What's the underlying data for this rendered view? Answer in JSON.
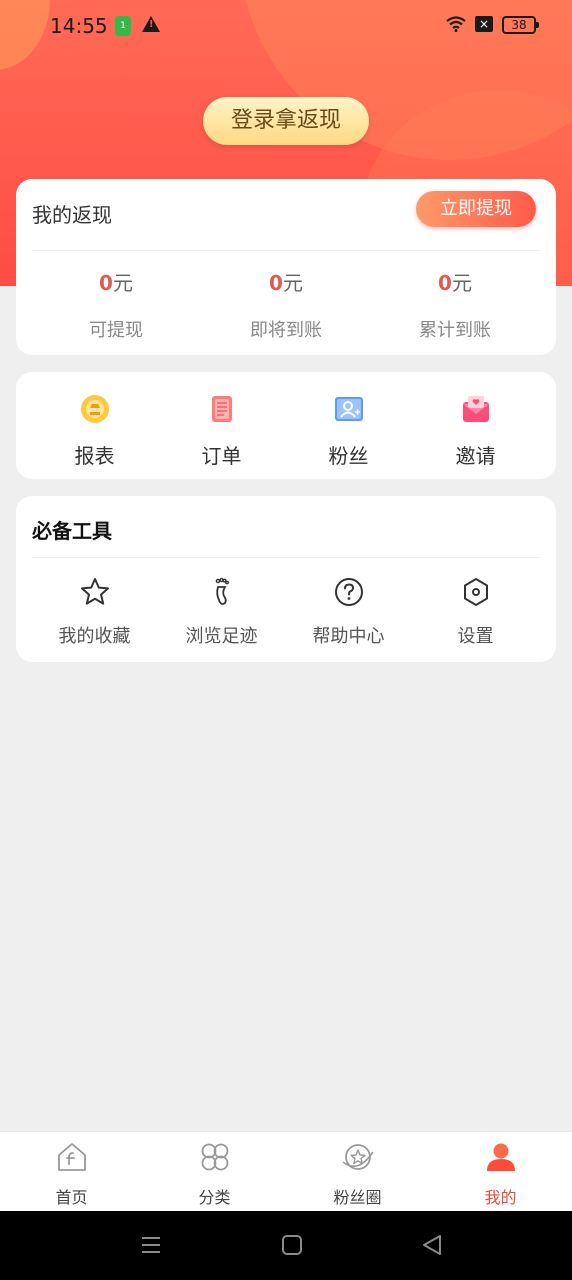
{
  "status_bar": {
    "time": "14:55",
    "battery": "38",
    "sim_label": "1"
  },
  "hero": {
    "login_button": "登录拿返现"
  },
  "cashback": {
    "title": "我的返现",
    "withdraw_button": "立即提现",
    "unit": "元",
    "stats": [
      {
        "value": "0",
        "label": "可提现"
      },
      {
        "value": "0",
        "label": "即将到账"
      },
      {
        "value": "0",
        "label": "累计到账"
      }
    ]
  },
  "menu": {
    "items": [
      {
        "label": "报表",
        "icon": "report-icon"
      },
      {
        "label": "订单",
        "icon": "order-icon"
      },
      {
        "label": "粉丝",
        "icon": "fans-icon"
      },
      {
        "label": "邀请",
        "icon": "invite-icon"
      }
    ]
  },
  "tools": {
    "title": "必备工具",
    "items": [
      {
        "label": "我的收藏",
        "icon": "star-icon"
      },
      {
        "label": "浏览足迹",
        "icon": "footprint-icon"
      },
      {
        "label": "帮助中心",
        "icon": "help-icon"
      },
      {
        "label": "设置",
        "icon": "settings-icon"
      }
    ]
  },
  "tabbar": {
    "tabs": [
      {
        "label": "首页",
        "icon": "home-icon",
        "active": false
      },
      {
        "label": "分类",
        "icon": "category-icon",
        "active": false
      },
      {
        "label": "粉丝圈",
        "icon": "fan-circle-icon",
        "active": false
      },
      {
        "label": "我的",
        "icon": "profile-icon",
        "active": true
      }
    ]
  },
  "colors": {
    "accent": "#e94b3c",
    "hero": "#ff5a4a",
    "gold_button": "#ffd884"
  }
}
